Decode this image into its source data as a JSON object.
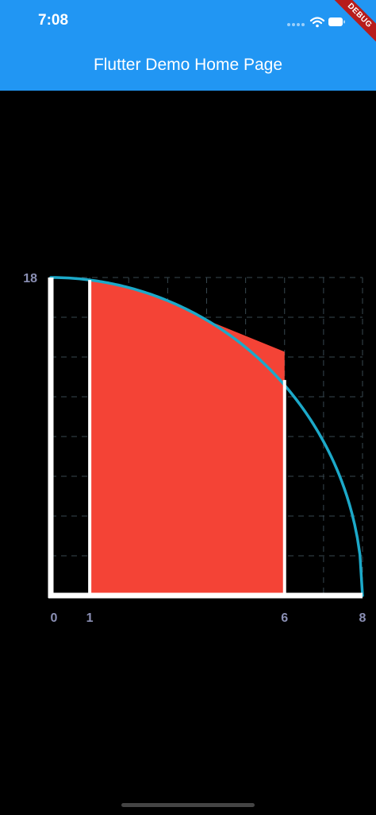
{
  "status_bar": {
    "time": "7:08",
    "icons": [
      "signal-dots-icon",
      "wifi-icon",
      "battery-icon"
    ]
  },
  "app_bar": {
    "title": "Flutter Demo Home Page",
    "background_color": "#2196F3",
    "debug_banner": "DEBUG"
  },
  "chart_data": {
    "type": "area",
    "title": "",
    "xlabel": "",
    "ylabel": "",
    "xlim": [
      0,
      8
    ],
    "ylim": [
      0,
      18
    ],
    "x_tick_labels": [
      "0",
      "1",
      "6",
      "8"
    ],
    "y_tick_labels": [
      "18"
    ],
    "grid": true,
    "curve": {
      "color": "#1CA9C9",
      "description": "quarter circle y = 18*sqrt(1-(x/8)^2)",
      "points": [
        {
          "x": 0,
          "y": 18
        },
        {
          "x": 1,
          "y": 17.86
        },
        {
          "x": 2,
          "y": 17.43
        },
        {
          "x": 3,
          "y": 16.69
        },
        {
          "x": 4,
          "y": 15.59
        },
        {
          "x": 5,
          "y": 14.05
        },
        {
          "x": 6,
          "y": 11.91
        },
        {
          "x": 7,
          "y": 8.71
        },
        {
          "x": 7.5,
          "y": 6.27
        },
        {
          "x": 8,
          "y": 0
        }
      ]
    },
    "approximation_area": {
      "color": "#F44336",
      "description": "shaded region from x=1 to x=6",
      "x_start": 1,
      "x_end": 6,
      "top_points": [
        {
          "x": 1,
          "y": 17.86
        },
        {
          "x": 2,
          "y": 17.43
        },
        {
          "x": 3,
          "y": 16.69
        },
        {
          "x": 4,
          "y": 15.59
        },
        {
          "x": 6,
          "y": 13.8
        }
      ]
    },
    "vertical_markers": [
      1,
      6
    ],
    "axis_color": "#FFFFFF",
    "tick_label_color": "#8A8FB4"
  }
}
